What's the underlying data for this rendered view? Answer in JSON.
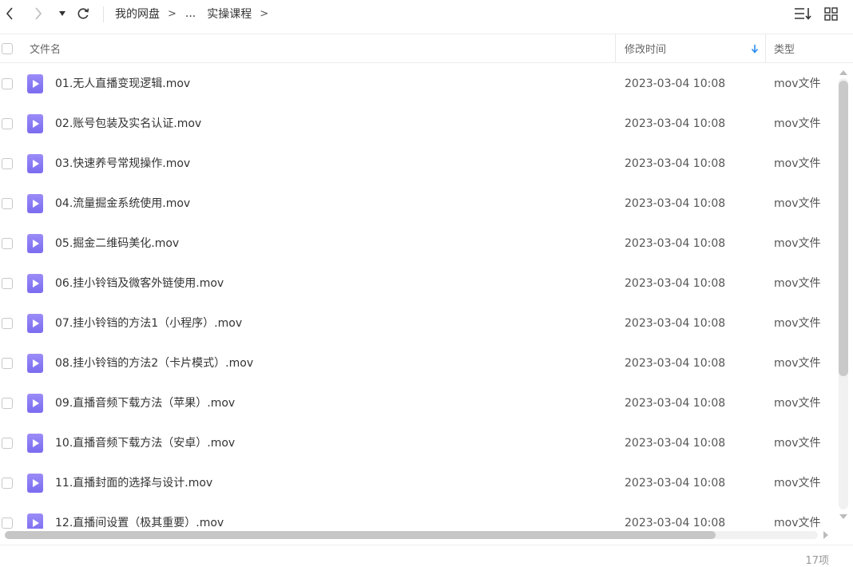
{
  "toolbar": {
    "breadcrumb": [
      {
        "label": "我的网盘",
        "sep": ">"
      },
      {
        "label": "...",
        "sep": ""
      },
      {
        "label": "实操课程",
        "sep": ">"
      }
    ]
  },
  "columns": {
    "name": "文件名",
    "time": "修改时间",
    "type": "类型"
  },
  "colors": {
    "accent": "#2b8ef2",
    "file_icon": "#8a7cf4"
  },
  "files": [
    {
      "name": "01.无人直播变现逻辑.mov",
      "time": "2023-03-04 10:08",
      "type": "mov文件"
    },
    {
      "name": "02.账号包装及实名认证.mov",
      "time": "2023-03-04 10:08",
      "type": "mov文件"
    },
    {
      "name": "03.快速养号常规操作.mov",
      "time": "2023-03-04 10:08",
      "type": "mov文件"
    },
    {
      "name": "04.流量掘金系统使用.mov",
      "time": "2023-03-04 10:08",
      "type": "mov文件"
    },
    {
      "name": "05.掘金二维码美化.mov",
      "time": "2023-03-04 10:08",
      "type": "mov文件"
    },
    {
      "name": "06.挂小铃铛及微客外链使用.mov",
      "time": "2023-03-04 10:08",
      "type": "mov文件"
    },
    {
      "name": "07.挂小铃铛的方法1（小程序）.mov",
      "time": "2023-03-04 10:08",
      "type": "mov文件"
    },
    {
      "name": "08.挂小铃铛的方法2（卡片模式）.mov",
      "time": "2023-03-04 10:08",
      "type": "mov文件"
    },
    {
      "name": "09.直播音频下载方法（苹果）.mov",
      "time": "2023-03-04 10:08",
      "type": "mov文件"
    },
    {
      "name": "10.直播音频下载方法（安卓）.mov",
      "time": "2023-03-04 10:08",
      "type": "mov文件"
    },
    {
      "name": "11.直播封面的选择与设计.mov",
      "time": "2023-03-04 10:08",
      "type": "mov文件"
    },
    {
      "name": "12.直播间设置（极其重要）.mov",
      "time": "2023-03-04 10:08",
      "type": "mov文件"
    }
  ],
  "footer": {
    "count": "17项"
  }
}
